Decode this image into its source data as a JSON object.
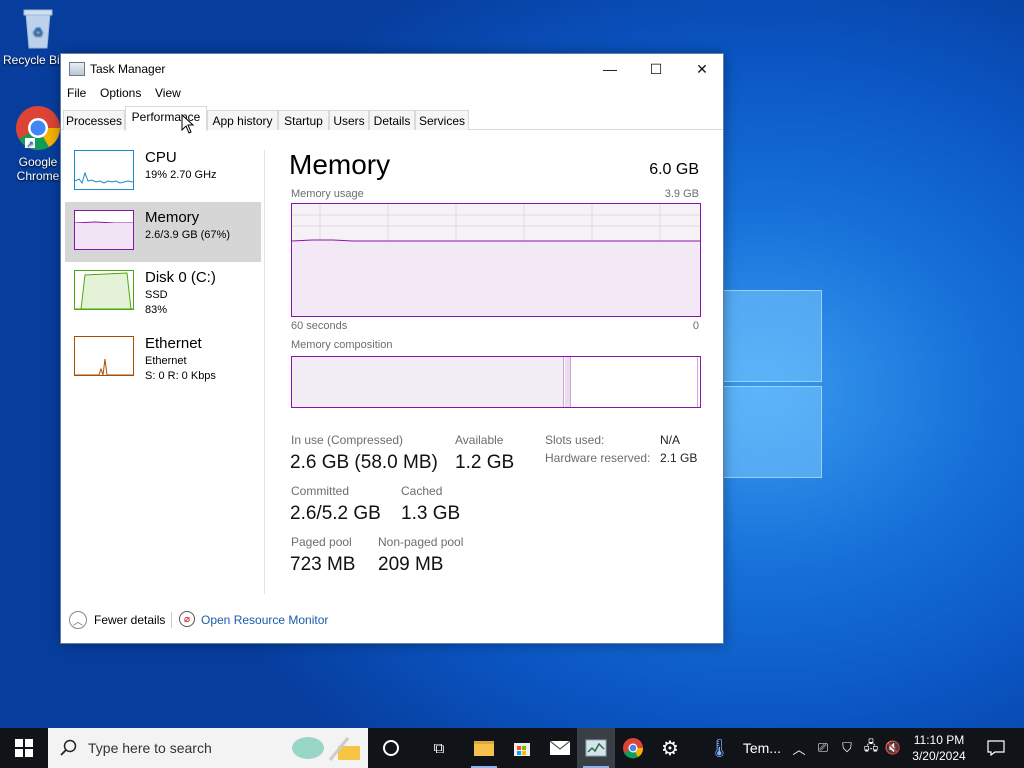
{
  "desktop": {
    "icons": [
      {
        "label": "Recycle Bin",
        "icon": "recycle-bin-icon"
      },
      {
        "label": "Google Chrome",
        "icon": "chrome-icon"
      }
    ]
  },
  "window": {
    "title": "Task Manager",
    "controls": {
      "minimize": "—",
      "maximize": "☐",
      "close": "✕"
    },
    "menu": [
      "File",
      "Options",
      "View"
    ],
    "tabs": [
      "Processes",
      "Performance",
      "App history",
      "Startup",
      "Users",
      "Details",
      "Services"
    ],
    "active_tab": "Performance"
  },
  "nav": [
    {
      "name": "CPU",
      "line1": "19%  2.70 GHz",
      "line2": "",
      "color": "#1b8bc9"
    },
    {
      "name": "Memory",
      "line1": "2.6/3.9 GB (67%)",
      "line2": "",
      "color": "#8b12ae"
    },
    {
      "name": "Disk 0 (C:)",
      "line1": "SSD",
      "line2": "83%",
      "color": "#4da60c"
    },
    {
      "name": "Ethernet",
      "line1": "Ethernet",
      "line2": "S: 0  R: 0 Kbps",
      "color": "#a74f01"
    }
  ],
  "memory": {
    "title": "Memory",
    "total": "6.0 GB",
    "usage_label": "Memory usage",
    "usage_max": "3.9 GB",
    "time_left": "60 seconds",
    "time_right": "0",
    "composition_label": "Memory composition",
    "usage_level": 0.67,
    "stats": {
      "in_use_label": "In use (Compressed)",
      "in_use_value": "2.6 GB (58.0 MB)",
      "available_label": "Available",
      "available_value": "1.2 GB",
      "committed_label": "Committed",
      "committed_value": "2.6/5.2 GB",
      "cached_label": "Cached",
      "cached_value": "1.3 GB",
      "paged_label": "Paged pool",
      "paged_value": "723 MB",
      "nonpaged_label": "Non-paged pool",
      "nonpaged_value": "209 MB",
      "slots_label": "Slots used:",
      "slots_value": "N/A",
      "hw_label": "Hardware reserved:",
      "hw_value": "2.1 GB"
    }
  },
  "footer": {
    "fewer_details": "Fewer details",
    "open_monitor": "Open Resource Monitor"
  },
  "taskbar": {
    "search_placeholder": "Type here to search",
    "pinned": [
      "task-view-icon",
      "file-explorer-icon",
      "store-icon",
      "mail-icon",
      "task-manager-icon",
      "chrome-icon",
      "settings-icon",
      "temperature-icon"
    ],
    "temp_label": "Tem...",
    "time": "11:10 PM",
    "date": "3/20/2024"
  }
}
